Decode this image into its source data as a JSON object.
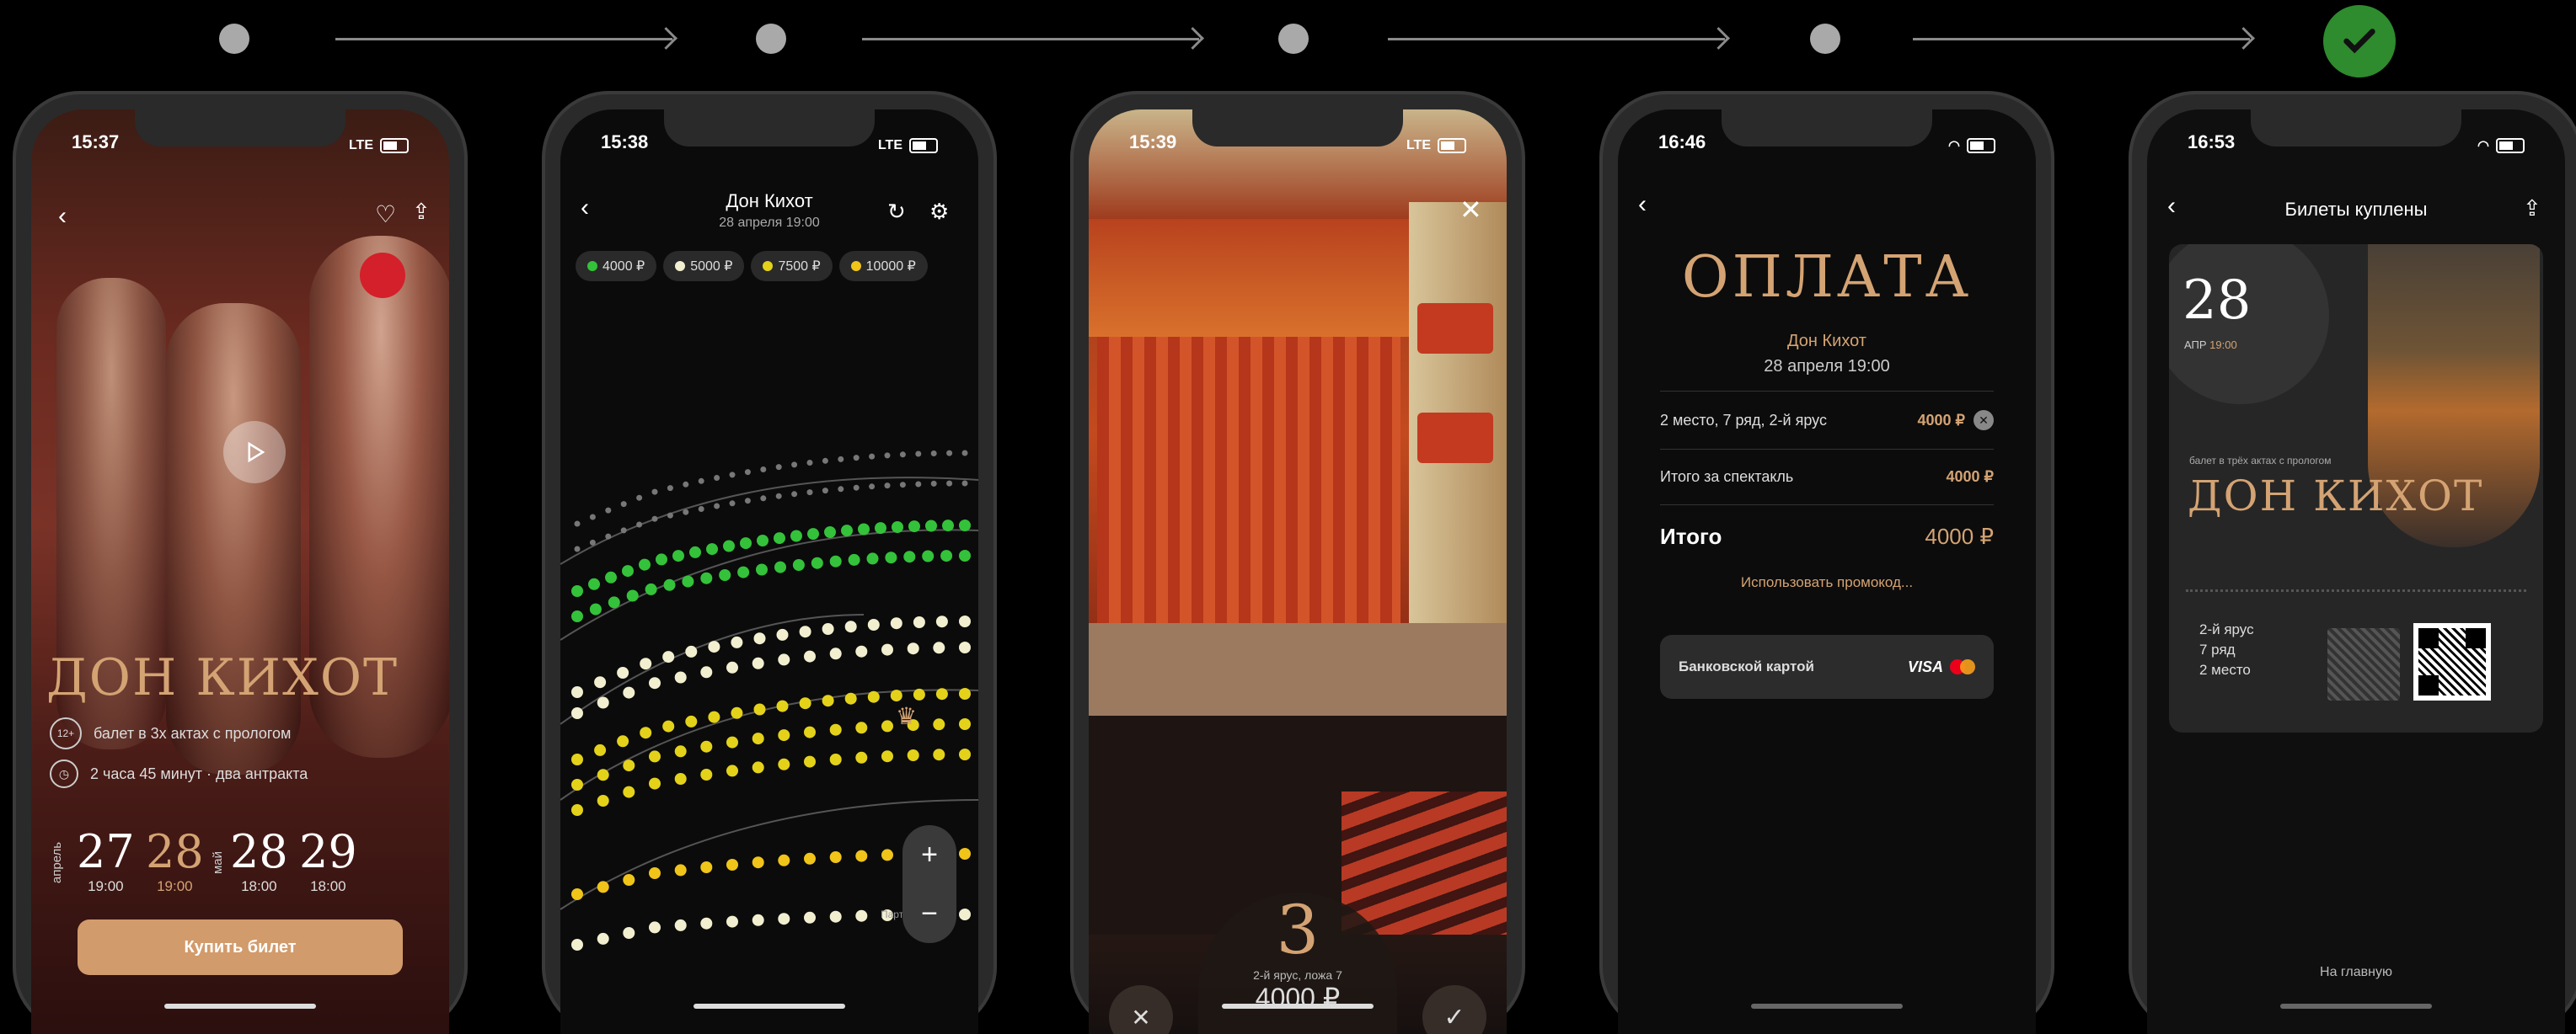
{
  "colors": {
    "accent": "#d4a373",
    "success": "#2e8b2e",
    "green": "#34c23a",
    "yellow": "#e4d21a",
    "cream": "#f2efd0"
  },
  "steps": {
    "done_icon": "check-icon"
  },
  "phone1": {
    "time": "15:37",
    "network": "LTE",
    "title": "ДОН КИХОТ",
    "age_badge": "12+",
    "description": "балет в 3х актах с прологом",
    "duration": "2 часа 45 минут · два антракта",
    "month1": "апрель",
    "month2": "май",
    "dates": [
      {
        "day": "27",
        "time": "19:00"
      },
      {
        "day": "28",
        "time": "19:00"
      },
      {
        "day": "28",
        "time": "18:00"
      },
      {
        "day": "29",
        "time": "18:00"
      }
    ],
    "buy_label": "Купить билет"
  },
  "phone2": {
    "time": "15:38",
    "network": "LTE",
    "title": "Дон Кихот",
    "subtitle": "28 апреля 19:00",
    "prices": [
      {
        "label": "4000 ₽",
        "color": "#34c23a"
      },
      {
        "label": "5000 ₽",
        "color": "#f2efd0"
      },
      {
        "label": "7500 ₽",
        "color": "#e4d21a"
      },
      {
        "label": "10000 ₽",
        "color": "#f0c419"
      }
    ],
    "section_label": "Партер"
  },
  "phone3": {
    "time": "15:39",
    "network": "LTE",
    "seat_number": "3",
    "seat_info": "2-й ярус, ложа 7",
    "price": "4000 ₽"
  },
  "phone4": {
    "time": "16:46",
    "heading": "ОПЛАТА",
    "show": "Дон Кихот",
    "date": "28 апреля 19:00",
    "seat_row": "2 место, 7 ряд, 2-й ярус",
    "seat_price": "4000 ₽",
    "subtotal_label": "Итого за спектакль",
    "subtotal": "4000 ₽",
    "total_label": "Итого",
    "total": "4000 ₽",
    "promo": "Использовать промокод...",
    "pay_method": "Банковской картой",
    "card_brand": "VISA"
  },
  "phone5": {
    "time": "16:53",
    "title": "Билеты куплены",
    "day": "28",
    "month": "АПР",
    "show_time": "19:00",
    "ticket_subtitle": "балет в трёх актах с прологом",
    "ticket_title": "ДОН КИХОТ",
    "tier": "2-й ярус",
    "row": "7 ряд",
    "place": "2 место",
    "home_link": "На главную"
  }
}
